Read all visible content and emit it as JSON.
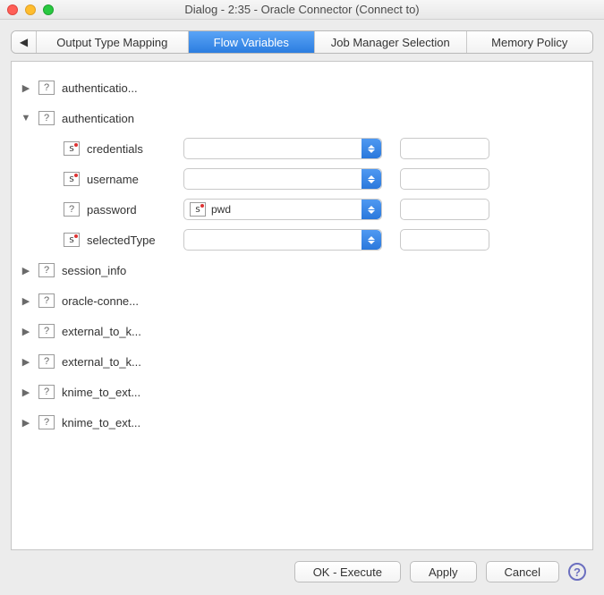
{
  "window_title": "Dialog - 2:35 - Oracle Connector (Connect to)",
  "tabs": {
    "output_type_mapping": "Output Type Mapping",
    "flow_variables": "Flow Variables",
    "job_manager": "Job Manager Selection",
    "memory_policy": "Memory Policy"
  },
  "tree": {
    "items": [
      {
        "label": "authenticatio...",
        "expanded": false
      },
      {
        "label": "authentication",
        "expanded": true
      },
      {
        "label": "session_info",
        "expanded": false
      },
      {
        "label": "oracle-conne...",
        "expanded": false
      },
      {
        "label": "external_to_k...",
        "expanded": false
      },
      {
        "label": "external_to_k...",
        "expanded": false
      },
      {
        "label": "knime_to_ext...",
        "expanded": false
      },
      {
        "label": "knime_to_ext...",
        "expanded": false
      }
    ]
  },
  "auth_children": {
    "credentials": {
      "label": "credentials",
      "dropdown": "",
      "text": ""
    },
    "username": {
      "label": "username",
      "dropdown": "",
      "text": ""
    },
    "password": {
      "label": "password",
      "dropdown": "pwd",
      "text": ""
    },
    "selectedType": {
      "label": "selectedType",
      "dropdown": "",
      "text": ""
    }
  },
  "buttons": {
    "ok": "OK - Execute",
    "apply": "Apply",
    "cancel": "Cancel"
  }
}
